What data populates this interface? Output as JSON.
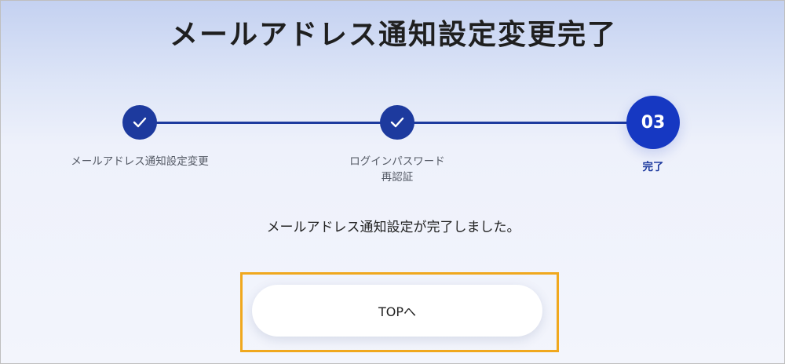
{
  "page": {
    "title": "メールアドレス通知設定変更完了",
    "message": "メールアドレス通知設定が完了しました。"
  },
  "stepper": {
    "steps": [
      {
        "label": "メールアドレス通知設定変更",
        "state": "done",
        "icon": "check-icon"
      },
      {
        "label_line1": "ログインパスワード",
        "label_line2": "再認証",
        "state": "done",
        "icon": "check-icon"
      },
      {
        "number": "03",
        "label": "完了",
        "state": "current"
      }
    ]
  },
  "actions": {
    "top_button_label": "TOPへ"
  },
  "colors": {
    "accent": "#1d3a9e",
    "current_step": "#1638c2",
    "highlight": "#f0a81e"
  }
}
